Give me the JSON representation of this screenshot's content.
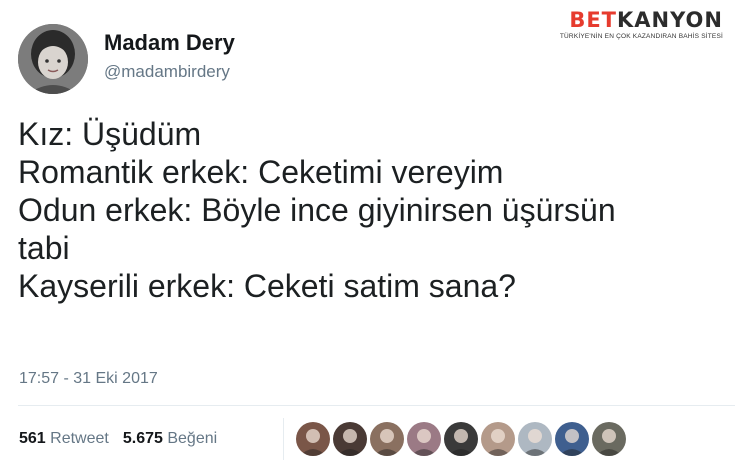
{
  "brand": {
    "logo_part1": "BET",
    "logo_part2": "KANYON",
    "tagline": "TÜRKİYE'NİN EN ÇOK KAZANDIRAN BAHİS SİTESİ"
  },
  "user": {
    "display_name": "Madam Dery",
    "handle": "@madambirdery"
  },
  "tweet": {
    "lines": [
      "Kız: Üşüdüm",
      "Romantik erkek: Ceketimi vereyim",
      "Odun erkek: Böyle ince giyinirsen üşürsün",
      "tabi",
      "Kayserili erkek: Ceketi satim sana?"
    ],
    "timestamp": "17:57 - 31 Eki 2017"
  },
  "stats": {
    "retweets_count": "561",
    "retweets_label": "Retweet",
    "likes_count": "5.675",
    "likes_label": "Beğeni"
  },
  "likers": [
    {
      "icon": "avatar-1",
      "color": "#7a5648"
    },
    {
      "icon": "avatar-2",
      "color": "#4a3a35"
    },
    {
      "icon": "avatar-3",
      "color": "#8a7060"
    },
    {
      "icon": "avatar-4",
      "color": "#9b7a85"
    },
    {
      "icon": "avatar-5",
      "color": "#3a3a3a"
    },
    {
      "icon": "avatar-6",
      "color": "#b49a8a"
    },
    {
      "icon": "avatar-7",
      "color": "#aeb8c2"
    },
    {
      "icon": "avatar-8",
      "color": "#3f5f8f"
    },
    {
      "icon": "avatar-9",
      "color": "#6a6a60"
    }
  ]
}
